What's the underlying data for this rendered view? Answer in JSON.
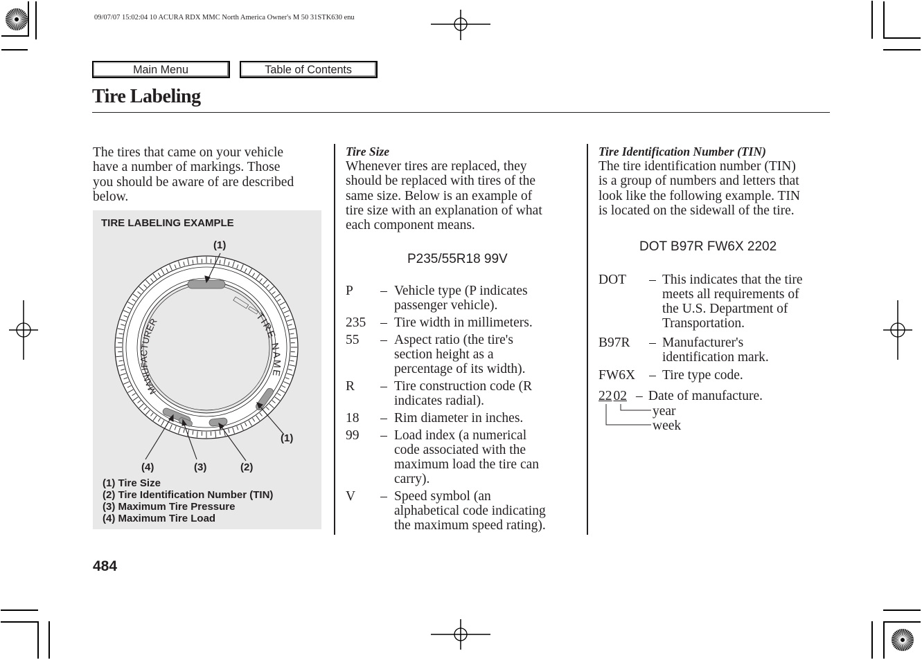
{
  "meta": {
    "print_header": "09/07/07 15:02:04    10 ACURA RDX MMC North America Owner's M 50 31STK630 enu"
  },
  "nav": {
    "main_menu_label": "Main Menu",
    "toc_label": "Table of Contents"
  },
  "page": {
    "title": "Tire Labeling",
    "number": "484"
  },
  "intro": {
    "lines": [
      "The tires that came on your vehicle",
      "have a number of markings. Those",
      "you should be aware of are described",
      "below."
    ]
  },
  "figure": {
    "heading": "TIRE LABELING EXAMPLE",
    "sidewall_text_left": "MANUFACTURER",
    "sidewall_text_right": "TIRE NAME",
    "callouts": {
      "top": "(1)",
      "right": "(1)",
      "c4": "(4)",
      "c3": "(3)",
      "c2": "(2)"
    },
    "legend": [
      "(1) Tire Size",
      "(2) Tire Identification Number (TIN)",
      "(3) Maximum Tire Pressure",
      "(4) Maximum Tire Load"
    ]
  },
  "tire_size": {
    "heading": "Tire Size",
    "lines": [
      "Whenever tires are replaced, they",
      "should be replaced with tires of the",
      "same size. Below is an example of",
      "tire size with an explanation of what",
      "each component means."
    ],
    "example": "P235/55R18 99V",
    "dash": "–",
    "definitions": [
      {
        "term": "P",
        "desc": [
          "Vehicle type (P indicates",
          "passenger vehicle)."
        ]
      },
      {
        "term": "235",
        "desc": [
          "Tire width in millimeters."
        ]
      },
      {
        "term": "55",
        "desc": [
          "Aspect ratio (the tire's",
          "section height as a",
          "percentage of its width)."
        ]
      },
      {
        "term": "R",
        "desc": [
          "Tire construction code (R",
          "indicates radial)."
        ]
      },
      {
        "term": "18",
        "desc": [
          "Rim diameter in inches."
        ]
      },
      {
        "term": "99",
        "desc": [
          "Load index (a numerical",
          "code associated with the",
          "maximum load the tire can",
          "carry)."
        ]
      },
      {
        "term": "V",
        "desc": [
          "Speed symbol (an",
          "alphabetical code indicating",
          "the maximum speed rating)."
        ]
      }
    ]
  },
  "tin": {
    "heading": "Tire Identification Number (TIN)",
    "lines": [
      "The tire identification number (TIN)",
      "is a group of numbers and letters that",
      "look like the following example. TIN",
      "is located on the sidewall of the tire."
    ],
    "example": "DOT B97R FW6X 2202",
    "dash": "–",
    "definitions": [
      {
        "term": "DOT",
        "desc": [
          "This indicates that the tire",
          "meets all requirements of",
          "the U.S. Department of",
          "Transportation."
        ]
      },
      {
        "term": "B97R",
        "desc": [
          "Manufacturer's",
          "identification mark."
        ]
      },
      {
        "term": "FW6X",
        "desc": [
          "Tire type code."
        ]
      }
    ],
    "date": {
      "week_part": "22",
      "year_part": "02",
      "desc": "Date of manufacture.",
      "year_label": "year",
      "week_label": "week"
    }
  }
}
